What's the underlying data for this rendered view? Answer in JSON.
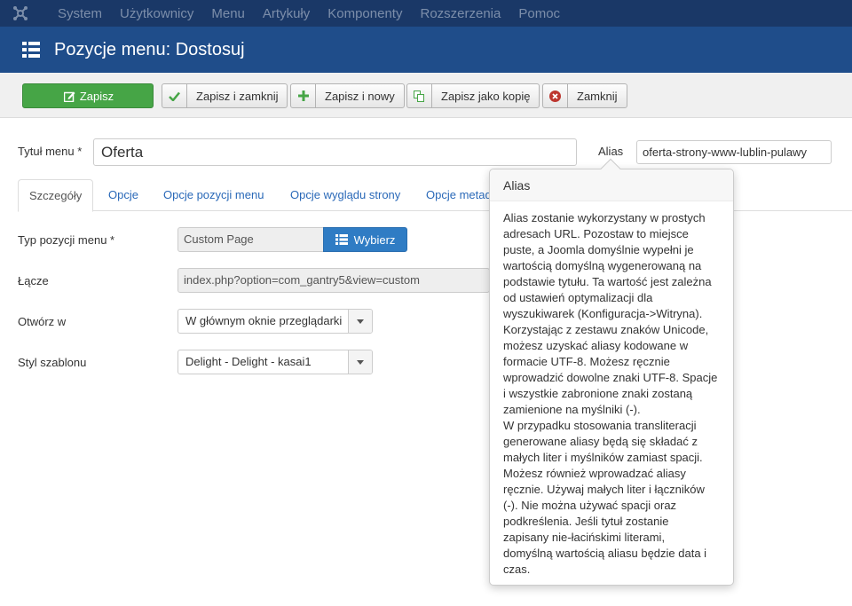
{
  "topnav": {
    "items": [
      "System",
      "Użytkownicy",
      "Menu",
      "Artykuły",
      "Komponenty",
      "Rozszerzenia",
      "Pomoc"
    ],
    "logo_icon": "joomla-logo-icon"
  },
  "header": {
    "title": "Pozycje menu: Dostosuj",
    "icon": "list-icon"
  },
  "toolbar": {
    "save": "Zapisz",
    "save_close": "Zapisz i zamknij",
    "save_new": "Zapisz i nowy",
    "save_copy": "Zapisz jako kopię",
    "close": "Zamknij"
  },
  "form": {
    "title_label": "Tytuł menu *",
    "title_value": "Oferta",
    "alias_label": "Alias",
    "alias_value": "oferta-strony-www-lublin-pulawy"
  },
  "tabs": [
    "Szczegóły",
    "Opcje",
    "Opcje pozycji menu",
    "Opcje wyglądu strony",
    "Opcje metad"
  ],
  "details": {
    "type_label": "Typ pozycji menu *",
    "type_value": "Custom Page",
    "choose_label": "Wybierz",
    "link_label": "Łącze",
    "link_value": "index.php?option=com_gantry5&view=custom",
    "open_label": "Otwórz w",
    "open_value": "W głównym oknie przeglądarki",
    "template_label": "Styl szablonu",
    "template_value": "Delight - Delight - kasai1"
  },
  "popover": {
    "title": "Alias",
    "body": "Alias zostanie wykorzystany w prostych\nadresach URL. Pozostaw to miejsce\npuste, a Joomla domyślnie wypełni je\nwartością domyślną wygenerowaną na\npodstawie tytułu. Ta wartość jest zależna\nod ustawień optymalizacji dla\nwyszukiwarek (Konfiguracja->Witryna).\nKorzystając z zestawu znaków Unicode,\nmożesz uzyskać aliasy kodowane w\nformacie UTF-8. Możesz ręcznie\nwprowadzić dowolne znaki UTF-8. Spacje\ni wszystkie zabronione znaki zostaną\nzamienione na myślniki (-).\nW przypadku stosowania transliteracji\ngenerowane aliasy będą się składać z\nmałych liter i myślników zamiast spacji.\nMożesz również wprowadzać aliasy\nręcznie. Używaj małych liter i łączników\n(-). Nie można używać spacji oraz\npodkreślenia. Jeśli tytuł zostanie\nzapisany nie-łacińskimi literami,\ndomyślną wartością aliasu będzie data i\nczas."
  },
  "colors": {
    "topnav_bg": "#1a3867",
    "header_bg": "#1f4d8a",
    "save_green": "#46a546",
    "primary_blue": "#2f7cc4",
    "link_blue": "#2a69b8"
  }
}
